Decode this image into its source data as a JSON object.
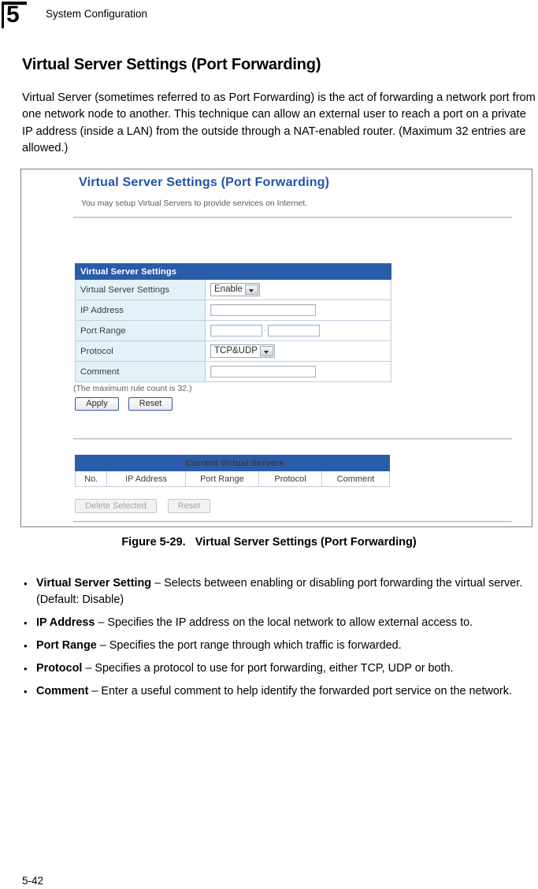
{
  "header": {
    "chapter_number": "5",
    "title": "System Configuration"
  },
  "section": {
    "heading": "Virtual Server Settings (Port Forwarding)",
    "intro": "Virtual Server (sometimes referred to as Port Forwarding) is the act of forwarding a network port from one network node to another. This technique can allow an external user to reach a port on a private IP address (inside a LAN) from the outside through a NAT-enabled router. (Maximum 32 entries are allowed.)"
  },
  "figure": {
    "ui": {
      "title": "Virtual Server Settings (Port Forwarding)",
      "subtitle": "You may setup Virtual Servers to provide services on Internet.",
      "settings_panel": {
        "banner": "Virtual Server Settings",
        "rows": [
          {
            "label": "Virtual Server Settings",
            "control": "select",
            "value": "Enable"
          },
          {
            "label": "IP Address",
            "control": "text",
            "value": ""
          },
          {
            "label": "Port Range",
            "control": "range",
            "value_start": "",
            "value_end": "",
            "separator": "-"
          },
          {
            "label": "Protocol",
            "control": "select",
            "value": "TCP&UDP"
          },
          {
            "label": "Comment",
            "control": "text",
            "value": ""
          }
        ],
        "note": "(The maximum rule count is 32.)",
        "apply_label": "Apply",
        "reset_label": "Reset"
      },
      "current_panel": {
        "banner": "Current Virtual Servers",
        "columns": [
          "No.",
          "IP Address",
          "Port Range",
          "Protocol",
          "Comment"
        ],
        "rows": [],
        "delete_selected_label": "Delete Selected",
        "reset_label": "Reset"
      },
      "colors": {
        "banner_blue": "#2a5caa",
        "title_blue": "#2353a8",
        "label_cell": "#e3f2f8",
        "border": "#bfcede"
      }
    },
    "caption_number": "Figure 5-29.",
    "caption_text": "Virtual Server Settings (Port Forwarding)"
  },
  "bullets": [
    {
      "term": "Virtual Server Setting",
      "description": " – Selects between enabling or disabling port forwarding the virtual server. (Default: Disable)"
    },
    {
      "term": "IP Address",
      "description": " – Specifies the IP address on the local network to allow external access to."
    },
    {
      "term": "Port Range",
      "description": " – Specifies the port range through which traffic is forwarded."
    },
    {
      "term": "Protocol",
      "description": " – Specifies a protocol to use for port forwarding, either TCP, UDP or both."
    },
    {
      "term": "Comment",
      "description": " – Enter a useful comment to help identify the forwarded port service on the network."
    }
  ],
  "footer": {
    "page_number": "5-42"
  }
}
